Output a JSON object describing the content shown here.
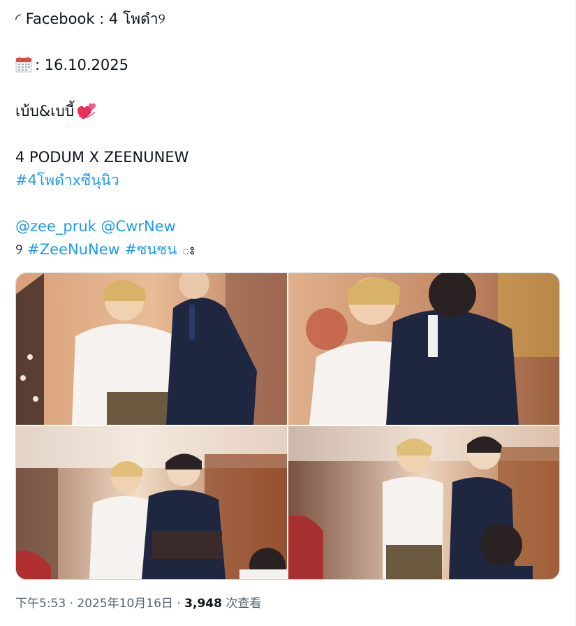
{
  "tweet": {
    "line1": "◜ Facebook : 4 โพดำ୨",
    "date_text": ": 16.10.2025",
    "couple_text": "เบ้บ&เบบี้",
    "brand_text": "4 PODUM X ZEENUNEW",
    "hashtag_1": "#4โพดำxซีนุนิว",
    "mention_1": "@zee_pruk",
    "mention_2": "@CwrNew",
    "bracket_open": "୨",
    "hashtag_2": "#ZeeNuNew",
    "hashtag_3": "#ซนซน",
    "bracket_close": "ః"
  },
  "icons": {
    "calendar": "calendar-icon",
    "heart": "revolving-hearts-icon"
  },
  "colors": {
    "link": "#1d9bf0",
    "text": "#0f1419",
    "meta": "#536471",
    "border": "#cfd9de"
  },
  "media": {
    "count": 4
  },
  "meta": {
    "time": "下午5:53",
    "sep1": "·",
    "date": "2025年10月16日",
    "sep2": "·",
    "views_count": "3,948",
    "views_label": "次查看"
  }
}
